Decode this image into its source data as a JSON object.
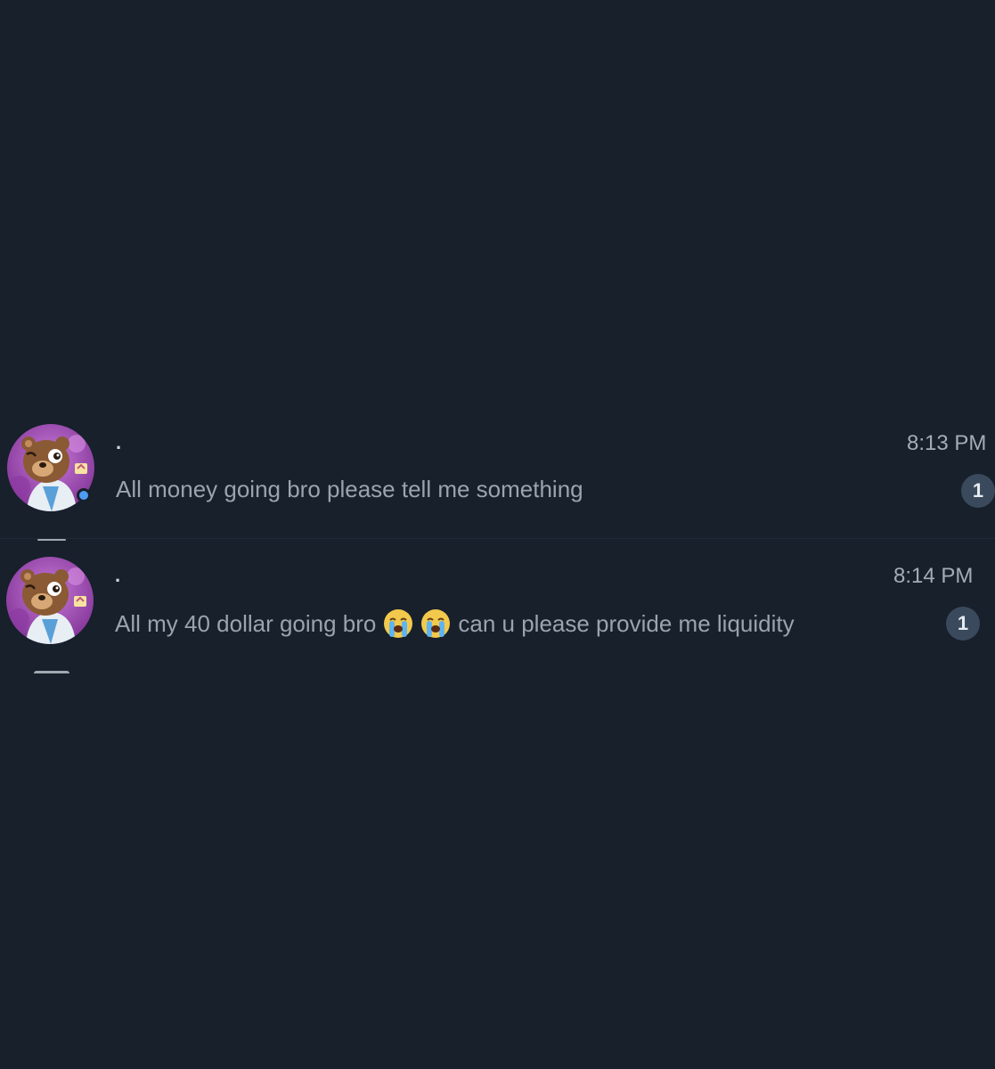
{
  "chats": [
    {
      "sender": ".",
      "message_text": "All money going bro please tell me something",
      "time": "8:13 PM",
      "unread_count": "1",
      "online": true
    },
    {
      "sender": ".",
      "message_before_emoji": "All my 40 dollar going bro",
      "emojis": [
        "loudly-crying-face-icon",
        "loudly-crying-face-icon"
      ],
      "message_after_emoji": "can u please provide me liquidity",
      "time": "8:14 PM",
      "unread_count": "1",
      "online": false
    }
  ],
  "colors": {
    "background": "#17202b",
    "online_dot": "#4f9cf5",
    "badge": "#3a4a5c",
    "avatar_bg": "#a24bbf"
  }
}
